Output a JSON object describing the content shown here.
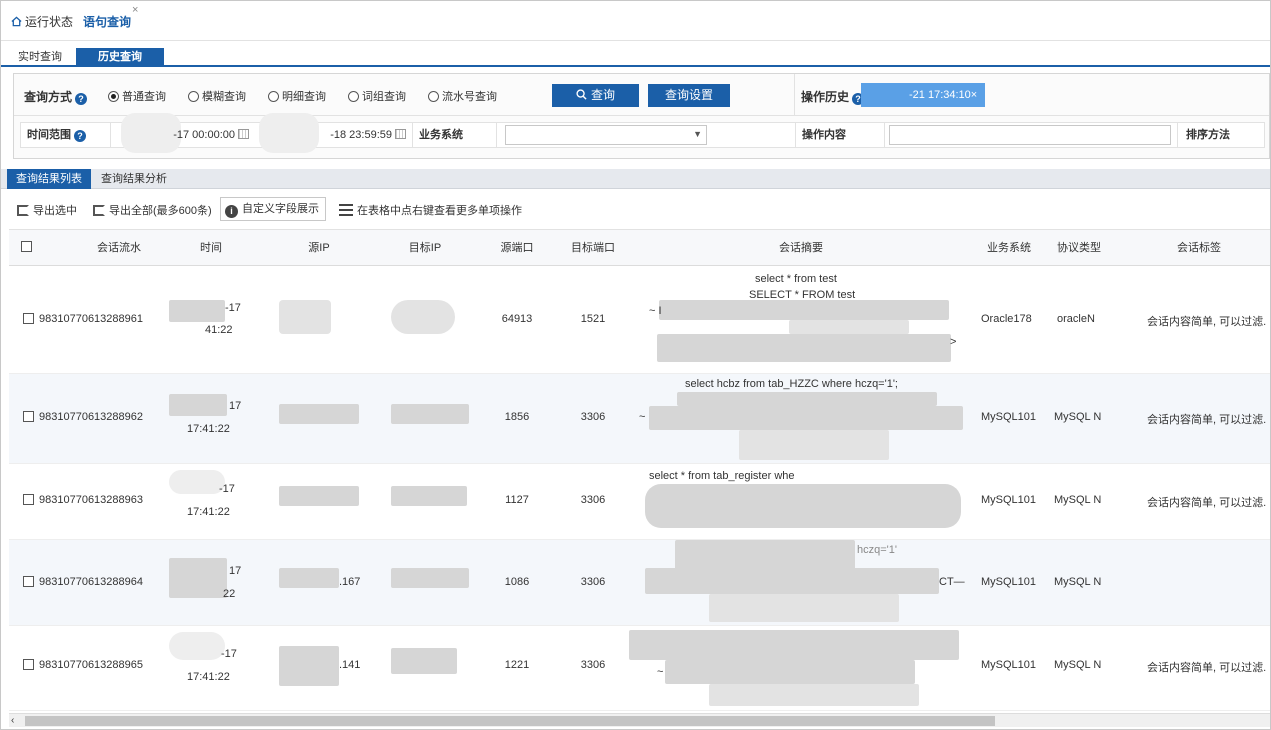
{
  "top_tabs": {
    "status": "运行状态",
    "query": "语句查询",
    "close": "×"
  },
  "sub_tabs": {
    "realtime": "实时查询",
    "history": "历史查询"
  },
  "query_panel": {
    "mode_label": "查询方式",
    "modes": [
      "普通查询",
      "模糊查询",
      "明细查询",
      "词组查询",
      "流水号查询"
    ],
    "selected_mode": "普通查询",
    "query_button": "查询",
    "settings_button": "查询设置",
    "history_label": "操作历史",
    "history_chip": "-21 17:34:10",
    "history_chip_close": "×",
    "time_label": "时间范围",
    "time_start": "-17 00:00:00",
    "time_end": "-18 23:59:59",
    "system_label": "业务系统",
    "system_value": "",
    "operation_label": "操作内容",
    "operation_value": "",
    "sort_label": "排序方法"
  },
  "result_tabs": {
    "list": "查询结果列表",
    "analysis": "查询结果分析"
  },
  "toolbar": {
    "export_selected": "导出选中",
    "export_all": "导出全部(最多600条)",
    "custom_fields": "自定义字段展示",
    "hint": "在表格中点右键查看更多单项操作"
  },
  "table": {
    "columns": [
      "会话流水",
      "时间",
      "源IP",
      "目标IP",
      "源端口",
      "目标端口",
      "会话摘要",
      "业务系统",
      "协议类型",
      "会话标签"
    ],
    "rows": [
      {
        "id": "98310770613288961",
        "time_top": "-17",
        "time_bottom": "41:22",
        "src_ip": "",
        "dst_ip": "",
        "src_port": "64913",
        "dst_port": "1521",
        "summary_lines": [
          "select * from test",
          "SELECT * FROM test",
          "~ I",
          ">"
        ],
        "system": "Oracle178",
        "protocol": "oracleN",
        "tag": "会话内容简单, 可以过滤."
      },
      {
        "id": "98310770613288962",
        "time_top": "17",
        "time_bottom": "17:41:22",
        "src_ip": "",
        "dst_ip": "",
        "src_port": "1856",
        "dst_port": "3306",
        "summary_lines": [
          "select hcbz from tab_HZZC where hczq='1';",
          "~"
        ],
        "system": "MySQL101",
        "protocol": "MySQL N",
        "tag": "会话内容简单, 可以过滤."
      },
      {
        "id": "98310770613288963",
        "time_top": "-17",
        "time_bottom": "17:41:22",
        "src_ip": "",
        "dst_ip": "",
        "src_port": "1127",
        "dst_port": "3306",
        "summary_lines": [
          "select * from tab_register whe"
        ],
        "system": "MySQL101",
        "protocol": "MySQL N",
        "tag": "会话内容简单, 可以过滤."
      },
      {
        "id": "98310770613288964",
        "time_top": "17",
        "time_bottom": "22",
        "src_ip": ".167",
        "dst_ip": "",
        "src_port": "1086",
        "dst_port": "3306",
        "summary_lines": [
          "hczq='1'",
          "CT—"
        ],
        "system": "MySQL101",
        "protocol": "MySQL N",
        "tag": ""
      },
      {
        "id": "98310770613288965",
        "time_top": "-17",
        "time_bottom": "17:41:22",
        "src_ip": ".141",
        "dst_ip": "",
        "src_port": "1221",
        "dst_port": "3306",
        "summary_lines": [
          "~"
        ],
        "system": "MySQL101",
        "protocol": "MySQL N",
        "tag": "会话内容简单, 可以过滤."
      }
    ]
  },
  "scrollbar": {
    "left_arrow": "‹"
  },
  "colors": {
    "accent": "#1b5fa8",
    "chip": "#5aa0e6"
  }
}
